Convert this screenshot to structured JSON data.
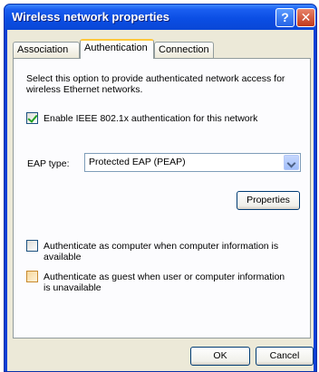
{
  "window": {
    "title": "Wireless network properties"
  },
  "titlebar_buttons": {
    "help": "?",
    "close": "✕"
  },
  "tabs": [
    {
      "label": "Association"
    },
    {
      "label": "Authentication"
    },
    {
      "label": "Connection"
    }
  ],
  "authentication": {
    "description": "Select this option to provide authenticated network access for wireless Ethernet networks.",
    "enable_8021x": {
      "label": "Enable IEEE 802.1x authentication for this network",
      "checked": true
    },
    "eap_type": {
      "label": "EAP type:",
      "value": "Protected EAP (PEAP)"
    },
    "properties_button": "Properties",
    "auth_as_computer": {
      "label": "Authenticate as computer when computer information is available",
      "checked": false
    },
    "auth_as_guest": {
      "label": "Authenticate as guest when user or computer information is unavailable",
      "checked": false
    }
  },
  "footer": {
    "ok": "OK",
    "cancel": "Cancel"
  },
  "colors": {
    "titlebar": "#0b4ee4",
    "dialog_bg": "#ece9d8",
    "panel_bg": "#fcfcfe",
    "active_tab_accent": "#ffc83c"
  }
}
